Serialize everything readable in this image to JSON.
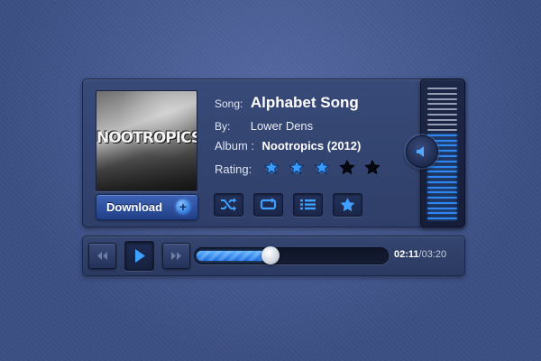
{
  "album_art": {
    "text": "NOOTROPICS"
  },
  "download": {
    "label": "Download",
    "icon": "plus-icon"
  },
  "song": {
    "label": "Song:",
    "title": "Alphabet Song"
  },
  "artist": {
    "label": "By:",
    "name": "Lower Dens"
  },
  "album": {
    "label": "Album :",
    "name": "Nootropics (2012)"
  },
  "rating": {
    "label": "Rating:",
    "value": 3,
    "max": 5
  },
  "actions": [
    {
      "name": "shuffle-button",
      "icon": "shuffle-icon"
    },
    {
      "name": "repeat-button",
      "icon": "repeat-icon"
    },
    {
      "name": "playlist-button",
      "icon": "list-icon"
    },
    {
      "name": "favorite-button",
      "icon": "star-icon"
    }
  ],
  "volume": {
    "level": 0.65,
    "icon": "speaker-icon"
  },
  "transport": {
    "prev_icon": "rewind-icon",
    "play_icon": "play-icon",
    "next_icon": "fast-forward-icon",
    "progress": 0.39
  },
  "time": {
    "current": "02:11",
    "separator": "/",
    "total": "03:20"
  },
  "colors": {
    "accent": "#2f86f0",
    "star_filled": "#3a9bff",
    "star_empty": "#050812",
    "panel": "#34456f"
  }
}
